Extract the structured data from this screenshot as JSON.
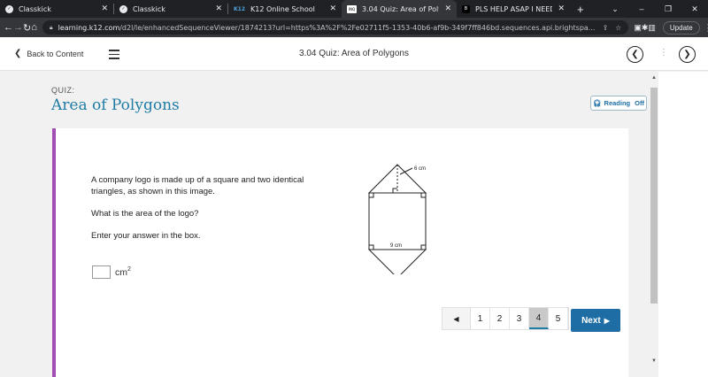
{
  "browser": {
    "tabs": [
      {
        "title": "Classkick",
        "favicon": "classkick-icon",
        "active": false
      },
      {
        "title": "Classkick",
        "favicon": "classkick-icon",
        "active": false
      },
      {
        "title": "K12 Online School",
        "favicon": "k12-icon",
        "favicon_text": "K12",
        "active": false
      },
      {
        "title": "3.04 Quiz: Area of Polygons",
        "favicon": "inquiry-icon",
        "favicon_text": "INQ",
        "active": true
      },
      {
        "title": "PLS HELP ASAP I NEED TO G",
        "favicon": "brainly-icon",
        "favicon_text": "B",
        "active": false
      }
    ],
    "url_domain": "learning.k12.com",
    "url_rest": "/d2l/le/enhancedSequenceViewer/1874213?url=https%3A%2F%2Fe02711f5-1353-40b6-af9b-349f7ff846bd.sequences.api.brightspa...",
    "update_label": "Update"
  },
  "header": {
    "back_label": "Back to Content",
    "title": "3.04 Quiz: Area of Polygons"
  },
  "quiz": {
    "label": "QUIZ:",
    "title": "Area of Polygons",
    "reading_label": "Reading",
    "reading_state": "Off"
  },
  "question": {
    "line1": "A company logo is made up of a square and two identical",
    "line2": "triangles, as shown in this image.",
    "prompt": "What is the area of the logo?",
    "instruction": "Enter your answer in the box.",
    "answer_value": "",
    "unit": "cm",
    "unit_exp": "2",
    "figure": {
      "height_label": "6 cm",
      "width_label": "9 cm"
    }
  },
  "pager": {
    "pages": [
      "1",
      "2",
      "3",
      "4",
      "5"
    ],
    "current": "4",
    "next_label": "Next"
  }
}
